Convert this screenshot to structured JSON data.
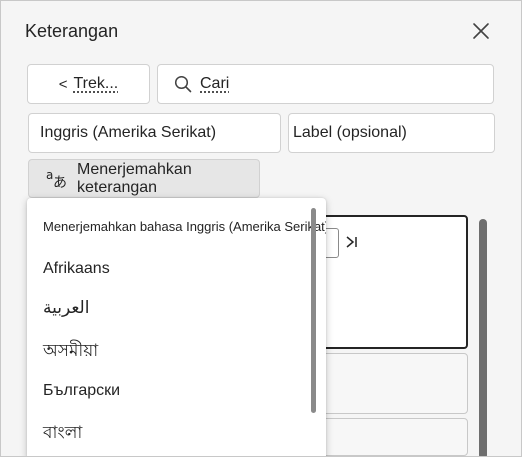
{
  "panel": {
    "title": "Keterangan",
    "close_icon": "close-icon"
  },
  "toolbar": {
    "back_glyph": "<",
    "back_label": "Trek...",
    "search_placeholder": "Cari",
    "search_icon": "search-icon"
  },
  "fields": {
    "language_value": "Inggris (Amerika Serikat)",
    "label_placeholder": "Label (opsional)"
  },
  "translate_button": {
    "label": "Menerjemahkan keterangan",
    "icon": "translate-icon"
  },
  "dropdown": {
    "header": "Menerjemahkan bahasa Inggris (Amerika Serikat) ke",
    "items": [
      "Afrikaans",
      "العربية",
      "অসমীয়া",
      "Български",
      "বাংলা"
    ]
  },
  "editor": {
    "next_icon": "skip-next-icon"
  },
  "colors": {
    "panel_bg": "#f5f5f5",
    "text": "#242424",
    "border": "#d1d1d1"
  }
}
